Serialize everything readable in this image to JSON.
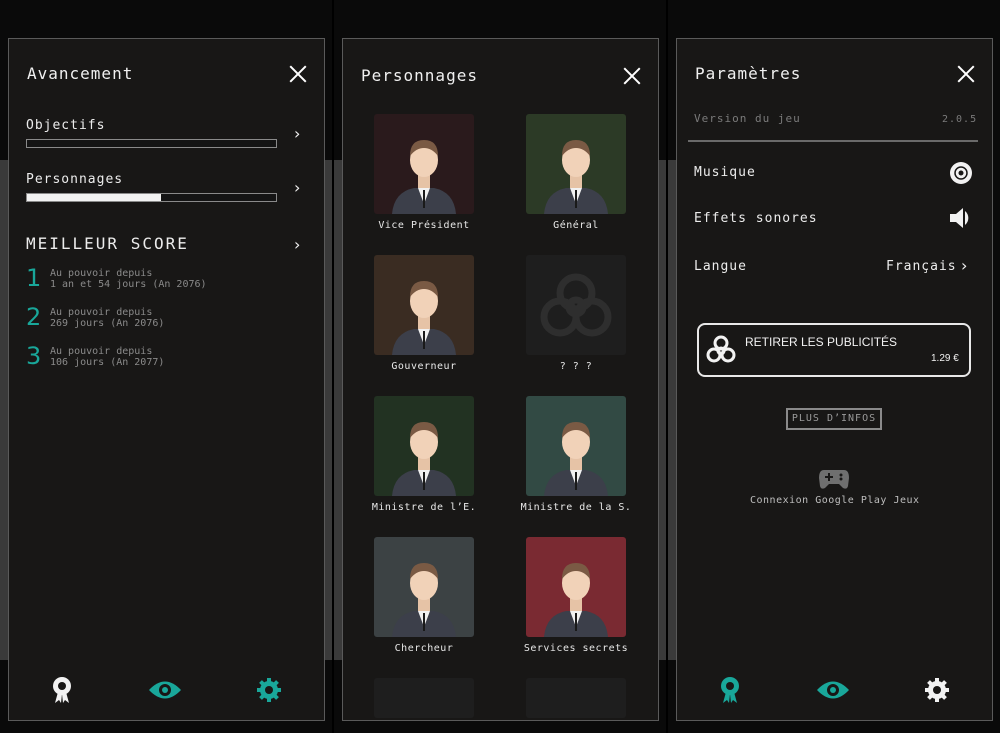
{
  "progress_panel": {
    "title": "Avancement",
    "objectives": {
      "label": "Objectifs",
      "progress": 0
    },
    "characters": {
      "label": "Personnages",
      "progress": 0.54
    },
    "best_score_title": "MEILLEUR SCORE",
    "scores": [
      {
        "rank": "1",
        "line1": "Au pouvoir depuis",
        "line2": "1 an et 54 jours (An 2076)"
      },
      {
        "rank": "2",
        "line1": "Au pouvoir depuis",
        "line2": "269 jours (An 2076)"
      },
      {
        "rank": "3",
        "line1": "Au pouvoir depuis",
        "line2": "106 jours (An 2077)"
      }
    ]
  },
  "characters_panel": {
    "title": "Personnages",
    "items": [
      {
        "name": "Vice Président",
        "bg": "#2a1a1c"
      },
      {
        "name": "Général",
        "bg": "#2c3a26"
      },
      {
        "name": "Gouverneur",
        "bg": "#3a2c22"
      },
      {
        "name": "? ? ?",
        "bg": "#1e1e1e"
      },
      {
        "name": "Ministre de l’E.",
        "bg": "#223222"
      },
      {
        "name": "Ministre de la S.",
        "bg": "#324a44"
      },
      {
        "name": "Chercheur",
        "bg": "#3c4244"
      },
      {
        "name": "Services secrets",
        "bg": "#7a2a32"
      }
    ]
  },
  "settings_panel": {
    "title": "Paramètres",
    "version_label": "Version du jeu",
    "version_value": "2.0.5",
    "music_label": "Musique",
    "sfx_label": "Effets sonores",
    "language_label": "Langue",
    "language_value": "Français",
    "remove_ads_label": "RETIRER LES PUBLICITÉS",
    "remove_ads_price": "1.29 €",
    "more_info_label": "PLUS D’INFOS",
    "google_play_label": "Connexion Google Play Jeux"
  },
  "colors": {
    "accent": "#19a79a",
    "panel_bg": "#181716"
  },
  "icons": [
    "close-icon",
    "chevron-right-icon",
    "award-icon",
    "eye-icon",
    "gear-icon",
    "biohazard-icon",
    "disc-icon",
    "speaker-icon",
    "gamepad-icon"
  ]
}
